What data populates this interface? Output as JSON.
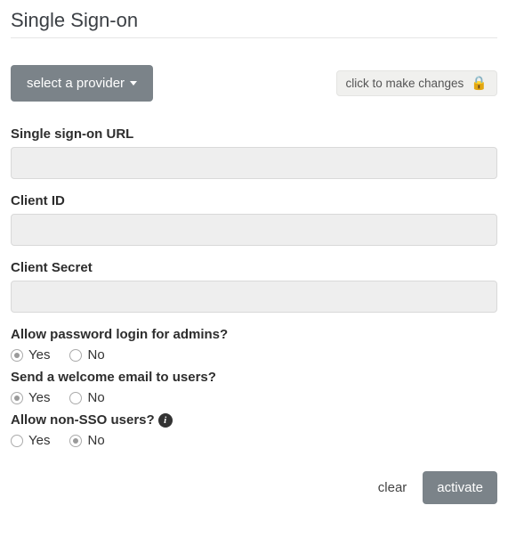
{
  "header": {
    "title": "Single Sign-on"
  },
  "top": {
    "provider_button_label": "select a provider",
    "lock_badge_text": "click to make changes"
  },
  "fields": {
    "sso_url": {
      "label": "Single sign-on URL",
      "value": ""
    },
    "client_id": {
      "label": "Client ID",
      "value": ""
    },
    "client_secret": {
      "label": "Client Secret",
      "value": ""
    }
  },
  "radios": {
    "password_login": {
      "question": "Allow password login for admins?",
      "yes": "Yes",
      "no": "No",
      "selected": "yes"
    },
    "welcome_email": {
      "question": "Send a welcome email to users?",
      "yes": "Yes",
      "no": "No",
      "selected": "yes"
    },
    "non_sso": {
      "question": "Allow non-SSO users?",
      "yes": "Yes",
      "no": "No",
      "selected": "no"
    }
  },
  "footer": {
    "clear": "clear",
    "activate": "activate"
  }
}
